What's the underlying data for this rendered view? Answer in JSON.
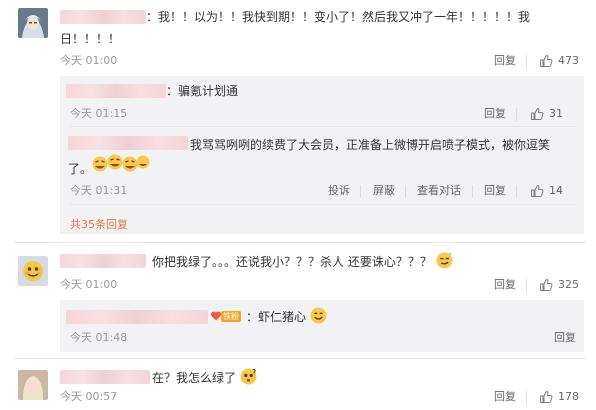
{
  "colors": {
    "accent": "#eb7350",
    "muted": "#999999",
    "reply_bg": "#f2f2f5"
  },
  "comments": [
    {
      "text_line1": "：我！！以为！！我快到期！！变小了！然后我又冲了一年！！！！！我",
      "text_line2": "日！！！！",
      "time": "今天 01:00",
      "reply_label": "回复",
      "likes": "473"
    },
    {
      "text": "你把我绿了。。。还说我小？？？杀人 还要诛心？？？",
      "time": "今天 01:00",
      "reply_label": "回复",
      "likes": "325"
    },
    {
      "text": "在？我怎么绿了",
      "time": "今天 00:57",
      "reply_label": "回复",
      "likes": "178"
    }
  ],
  "replies_1": [
    {
      "text": "：骗氪计划通",
      "time": "今天 01:15",
      "reply_label": "回复",
      "likes": "31"
    },
    {
      "text_line1": "我骂骂咧咧的续费了大会员，正准备上微博开启喷子模式，被你逗笑",
      "text_line2": "了。",
      "time": "今天 01:31",
      "actions": {
        "report": "投诉",
        "block": "屏蔽",
        "view_dialog": "查看对话",
        "reply": "回复"
      },
      "likes": "14"
    }
  ],
  "more_replies": "共35条回复",
  "replies_2": [
    {
      "badge": "铁粉",
      "text": "：虾仁猪心",
      "time": "今天 01:48",
      "reply_label": "回复"
    }
  ]
}
